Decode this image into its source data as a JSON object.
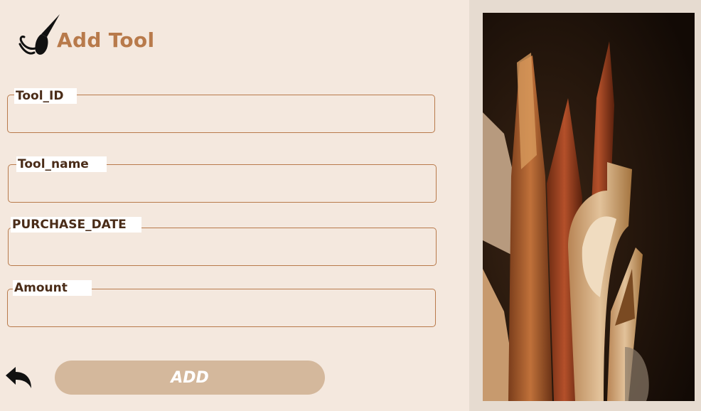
{
  "header": {
    "title": "Add Tool",
    "logo_icon": "brush-icon"
  },
  "form": {
    "fields": [
      {
        "label": "Tool_ID",
        "value": ""
      },
      {
        "label": "Tool_name",
        "value": ""
      },
      {
        "label": "PURCHASE_DATE",
        "value": ""
      },
      {
        "label": "Amount",
        "value": ""
      }
    ],
    "add_label": "ADD",
    "back_icon": "back-arrow-icon"
  },
  "colors": {
    "background": "#f4e8de",
    "accent": "#b87a4b",
    "label_text": "#4a2c18",
    "button": "#d4b89c"
  }
}
